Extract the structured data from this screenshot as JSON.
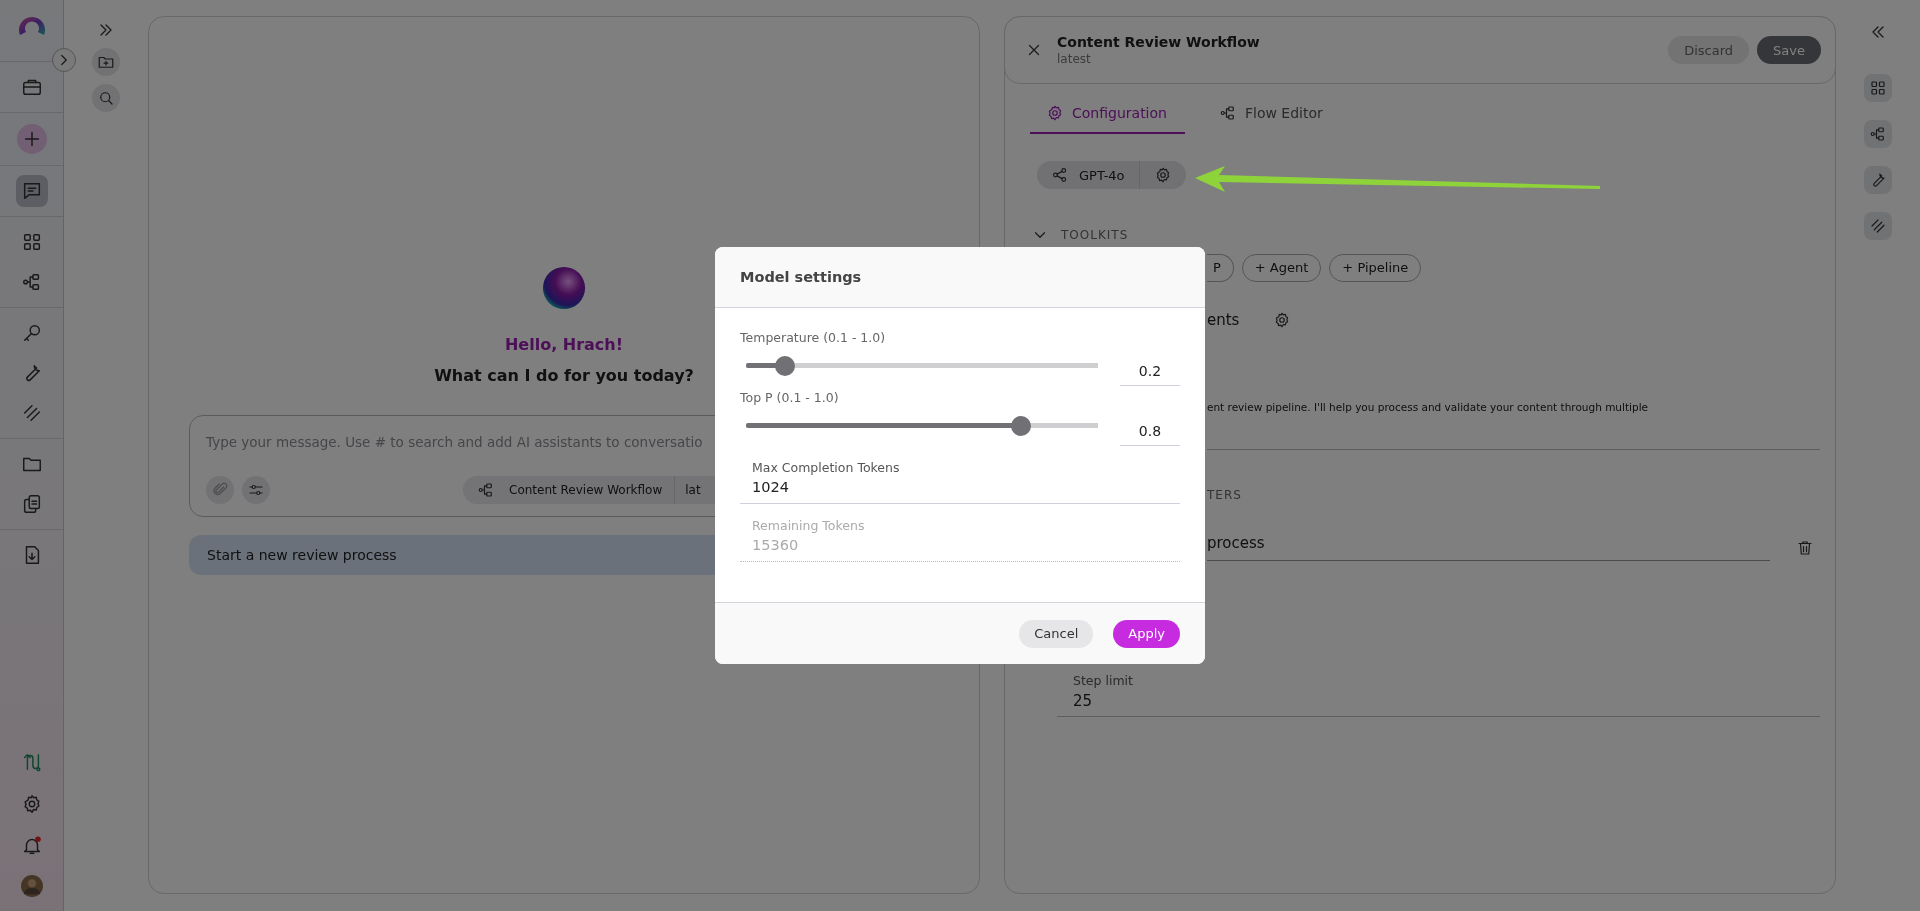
{
  "nav_rail": {
    "items": [
      {
        "selected": false
      },
      {
        "selected": false
      },
      {
        "selected": true
      },
      {
        "selected": false
      },
      {
        "selected": false
      },
      {
        "selected": false
      },
      {
        "selected": false
      },
      {
        "selected": false
      },
      {
        "selected": false
      },
      {
        "selected": false
      },
      {
        "selected": false
      }
    ],
    "notifications": {
      "unread": true
    }
  },
  "chat": {
    "greeting": "Hello, Hrach!",
    "prompt": "What can I do for you today?",
    "input": {
      "placeholder": "Type your message. Use # to search and add AI assistants to conversatio"
    },
    "agent_chip": {
      "name": "Content Review Workflow",
      "version": "lat"
    },
    "suggestions": [
      "Start a new review process"
    ]
  },
  "agent_panel": {
    "title": "Content Review Workflow",
    "subtitle": "latest",
    "buttons": [
      {
        "label": "Discard",
        "disabled": true
      },
      {
        "label": "Save",
        "disabled": false
      }
    ],
    "tabs": [
      {
        "label": "Configuration",
        "selected": true
      },
      {
        "label": "Flow Editor",
        "selected": false
      }
    ],
    "model_chip": {
      "label": "GPT-4o"
    },
    "toolkits": {
      "heading": "TOOLKITS",
      "expanded": true,
      "chips": [
        "P",
        "+ Agent",
        "+ Pipeline"
      ]
    },
    "section_partial": "ents",
    "instructions_partial": "ent review pipeline. I'll help you process and validate your content through multiple",
    "parameters_heading_partial": "TERS",
    "conversation_starters": [
      {
        "value": "process"
      }
    ],
    "step_limit": {
      "label": "Step limit",
      "value": "25"
    }
  },
  "modal": {
    "title": "Model settings",
    "sliders": [
      {
        "label": "Temperature (0.1 - 1.0)",
        "level": 0.11,
        "reading": "0.2"
      },
      {
        "label": "Top P (0.1 - 1.0)",
        "level": 0.78,
        "reading": "0.8"
      }
    ],
    "fields": [
      {
        "label": "Max Completion Tokens",
        "value": "1024",
        "disabled": false
      },
      {
        "label": "Remaining Tokens",
        "value": "15360",
        "disabled": true
      }
    ],
    "buttons": [
      {
        "label": "Cancel",
        "kind": "secondary"
      },
      {
        "label": "Apply",
        "kind": "primary"
      }
    ]
  }
}
